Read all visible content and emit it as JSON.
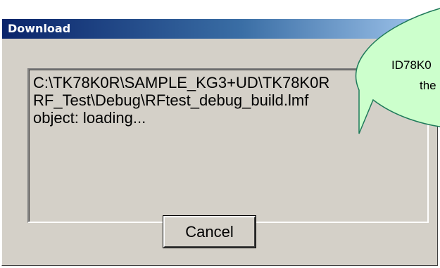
{
  "window": {
    "title": "Download"
  },
  "log": {
    "lines": [
      "C:\\TK78K0R\\SAMPLE_KG3+UD\\TK78K0R",
      "RF_Test\\Debug\\RFtest_debug_build.lmf",
      "object: loading..."
    ]
  },
  "buttons": {
    "cancel_label": "Cancel"
  },
  "callout": {
    "line1": "ID78K0",
    "line2": "the"
  },
  "colors": {
    "dialog_face": "#d4d0c8",
    "titlebar_start": "#0a246a",
    "titlebar_end": "#a6caf0",
    "callout_fill": "#ccffcc",
    "callout_stroke": "#1f7a5a"
  }
}
